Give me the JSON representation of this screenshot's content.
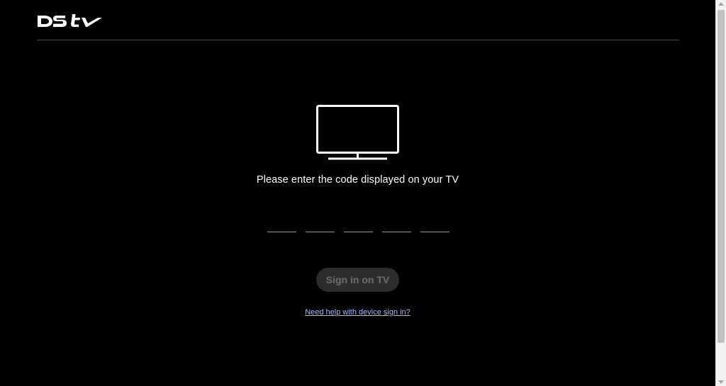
{
  "brand": {
    "logo_text": "DStv",
    "logo_color": "#ffffff"
  },
  "main": {
    "icon": "tv-icon",
    "prompt": "Please enter the code displayed on your TV",
    "code_fields": [
      {
        "value": "",
        "placeholder": ""
      },
      {
        "value": "",
        "placeholder": ""
      },
      {
        "value": "",
        "placeholder": ""
      },
      {
        "value": "",
        "placeholder": ""
      },
      {
        "value": "",
        "placeholder": ""
      }
    ],
    "signin_label": "Sign in on TV",
    "help_link": "Need help with device sign in?"
  },
  "colors": {
    "background": "#000000",
    "text": "#ffffff",
    "button_disabled_bg": "#2d2d2d",
    "button_disabled_text": "#6e6e6e",
    "link": "#aab8ff"
  }
}
